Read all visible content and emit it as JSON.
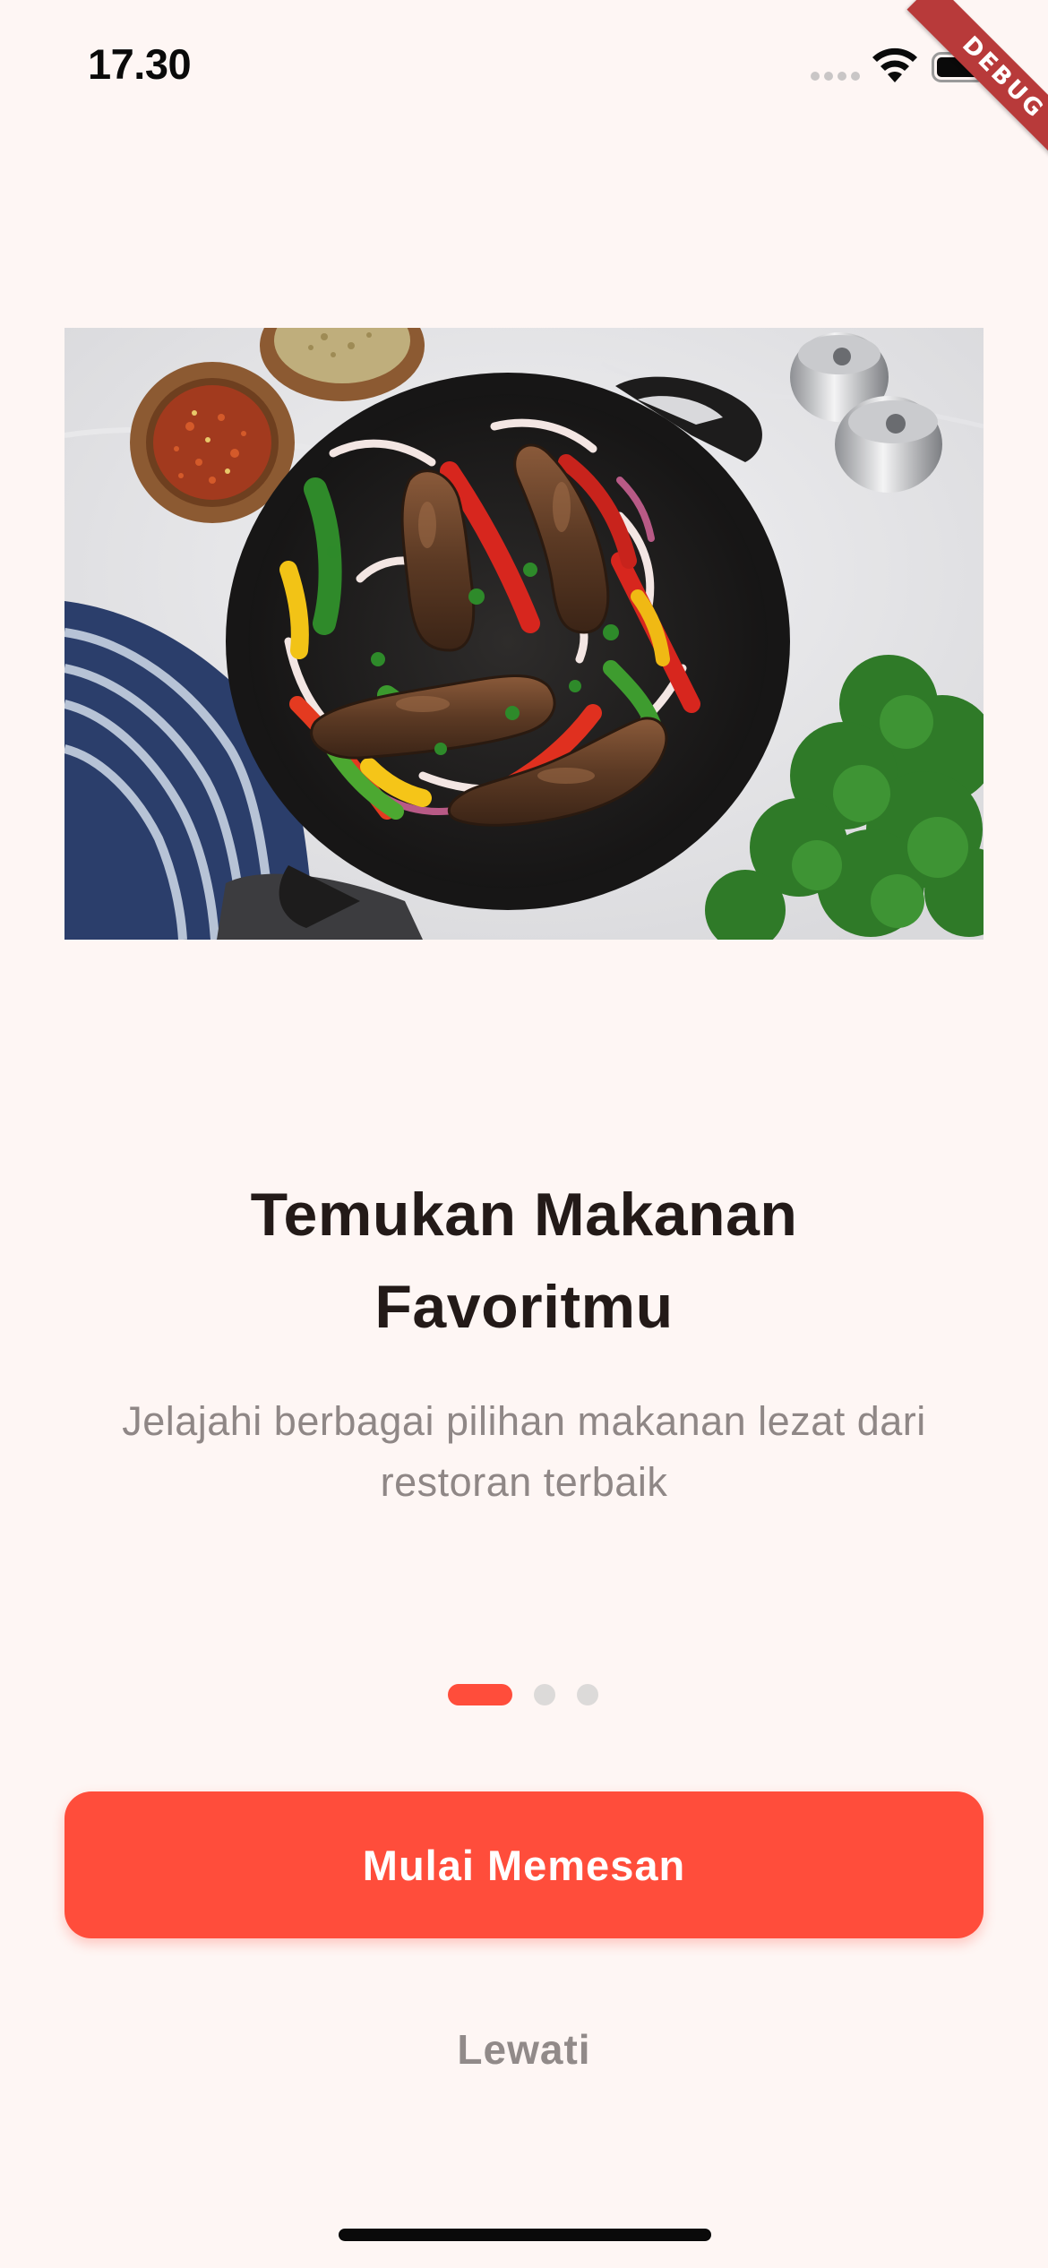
{
  "status_bar": {
    "time": "17.30",
    "icons": [
      "cellular-signal-icon",
      "wifi-icon",
      "battery-icon"
    ]
  },
  "debug_banner": {
    "label": "DEBUG",
    "color": "#B83A3A"
  },
  "hero_image": {
    "subject": "cast-iron-skillet-sausages-peppers"
  },
  "onboarding": {
    "title_line1": "Temukan Makanan",
    "title_line2": "Favoritmu",
    "subtitle_line1": "Jelajahi berbagai pilihan makanan lezat dari",
    "subtitle_line2": "restoran terbaik"
  },
  "page_indicator": {
    "current": 1,
    "total": 3
  },
  "actions": {
    "primary_label": "Mulai Memesan",
    "skip_label": "Lewati"
  },
  "colors": {
    "background": "#FEF6F4",
    "accent": "#FF4D3B",
    "title_text": "#231A18",
    "muted_text": "#8F8786",
    "dot_inactive": "#DCDAD9"
  }
}
